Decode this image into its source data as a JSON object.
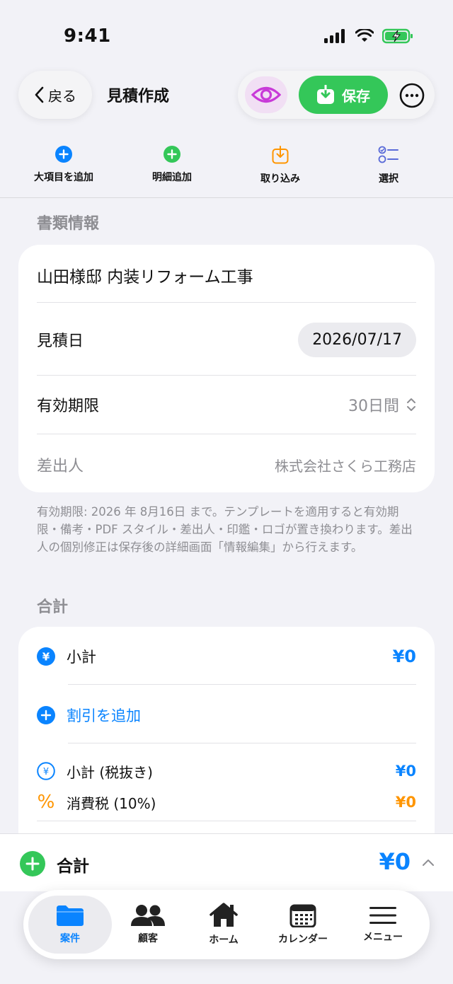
{
  "status": {
    "time": "9:41"
  },
  "nav": {
    "back_label": "戻る",
    "title": "見積作成",
    "save_label": "保存"
  },
  "toolbar": [
    {
      "label": "大項目を追加",
      "icon": "plus-circle-blue"
    },
    {
      "label": "明細追加",
      "icon": "plus-circle-green"
    },
    {
      "label": "取り込み",
      "icon": "tray-arrow-down-orange"
    },
    {
      "label": "選択",
      "icon": "checklist-blue"
    }
  ],
  "document_info": {
    "header": "書類情報",
    "title": "山田様邸 内装リフォーム工事",
    "estimate_date_label": "見積日",
    "estimate_date": "2026/07/17",
    "validity_label": "有効期限",
    "validity_value": "30日間",
    "issuer_label": "差出人",
    "issuer_value": "株式会社さくら工務店",
    "note": "有効期限: 2026 年 8月16日 まで。テンプレートを適用すると有効期限・備考・PDF スタイル・差出人・印鑑・ロゴが置き換わります。差出人の個別修正は保存後の詳細画面「情報編集」から行えます。"
  },
  "totals": {
    "header": "合計",
    "subtotal_label": "小計",
    "subtotal_value": "¥0",
    "add_discount_label": "割引を追加",
    "subtotal_ex_tax_label": "小計 (税抜き)",
    "subtotal_ex_tax_value": "¥0",
    "tax_label": "消費税 (10%)",
    "tax_value": "¥0"
  },
  "bottom_total": {
    "label": "合計",
    "value": "¥0"
  },
  "tabs": [
    {
      "label": "案件",
      "icon": "folder-icon",
      "active": true
    },
    {
      "label": "顧客",
      "icon": "people-icon",
      "active": false
    },
    {
      "label": "ホーム",
      "icon": "home-icon",
      "active": false
    },
    {
      "label": "カレンダー",
      "icon": "calendar-icon",
      "active": false
    },
    {
      "label": "メニュー",
      "icon": "menu-icon",
      "active": false
    }
  ],
  "colors": {
    "blue": "#0a84ff",
    "green": "#34c759",
    "orange": "#ff9500",
    "purple": "#c83ad8",
    "background": "#f2f2f7"
  }
}
